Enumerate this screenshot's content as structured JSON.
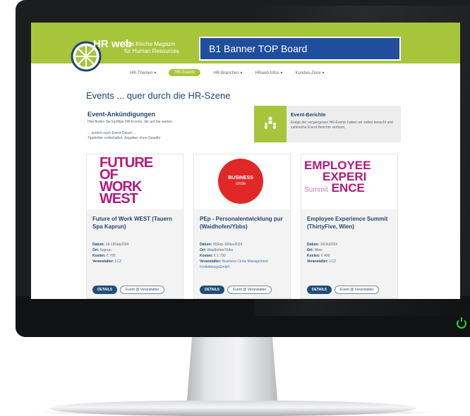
{
  "site": {
    "logo_text": "HR web",
    "tagline_line1": "Das frische Magazin",
    "tagline_line2": "für Human Resources",
    "banner_label": "B1 Banner TOP Board"
  },
  "nav": {
    "items": [
      {
        "label": "HR-Themen ▾",
        "active": false
      },
      {
        "label": "HR-Events",
        "active": true
      },
      {
        "label": "HR-Branchen ▾",
        "active": false
      },
      {
        "label": "HRweb Infos ▾",
        "active": false
      },
      {
        "label": "Kunden-Zone ▾",
        "active": false
      }
    ]
  },
  "page": {
    "title": "Events ... quer durch die HR-Szene",
    "announce_title": "Event-Ankündigungen",
    "announce_text": "Hier finden Sie künftige HR-Events, die auf Sie warten.",
    "announce_sort": "... sortiert nach Event-Datum ...",
    "announce_note": "Tippfehler vorbehalten, Angaben ohne Gewähr"
  },
  "report": {
    "title": "Event-Berichte",
    "text": "Einige der vergangenen HR-Events haben wir selbst besucht und zahlreiche Event-Berichte verfasst."
  },
  "cards": [
    {
      "image_text": [
        "FUTURE",
        "OF",
        "WORK",
        "WEST"
      ],
      "title": "Future of Work WEST (Tauern Spa Kaprun)",
      "datum_label": "Datum:",
      "datum": "18-19Sep2024",
      "ort_label": "Ort:",
      "ort": "Kaprun",
      "kosten_label": "Kosten:",
      "kosten": "€ 750",
      "veranstalter_label": "Veranstalter:",
      "veranstalter": "LCZ",
      "details_label": "DETAILS",
      "event_label": "Event @ Veranstalter"
    },
    {
      "image_text": [
        "BUSINESS",
        "circle"
      ],
      "title": "PEp - Personalentwicklung pur (Waidhofen/Ybbs)",
      "datum_label": "Datum:",
      "datum": "26Sep-16Nov2024",
      "ort_label": "Ort:",
      "ort": "Waidhofen/Ybbs",
      "kosten_label": "Kosten:",
      "kosten": "€ 1.790",
      "veranstalter_label": "Veranstalter:",
      "veranstalter": "Business Circle Management FortbildungsGmbH",
      "details_label": "DETAILS",
      "event_label": "Event @ Veranstalter"
    },
    {
      "image_text": [
        "EMPLOYEE",
        "EXPERI",
        "Summit",
        "ENCE"
      ],
      "title": "Employee Experience Summit (ThirtyFive, Wien)",
      "datum_label": "Datum:",
      "datum": "16Okt2024",
      "ort_label": "Ort:",
      "ort": "Wien",
      "kosten_label": "Kosten:",
      "kosten": "€ 490",
      "veranstalter_label": "Veranstalter:",
      "veranstalter": "LCZ",
      "details_label": "DETAILS",
      "event_label": "Event @ Veranstalter"
    }
  ],
  "colors": {
    "brand_green": "#a7c53b",
    "banner_blue": "#1f4e9c",
    "heading_blue": "#24466e",
    "accent_magenta": "#b3197b",
    "business_red": "#e22727",
    "power_led": "#2bd33b"
  }
}
